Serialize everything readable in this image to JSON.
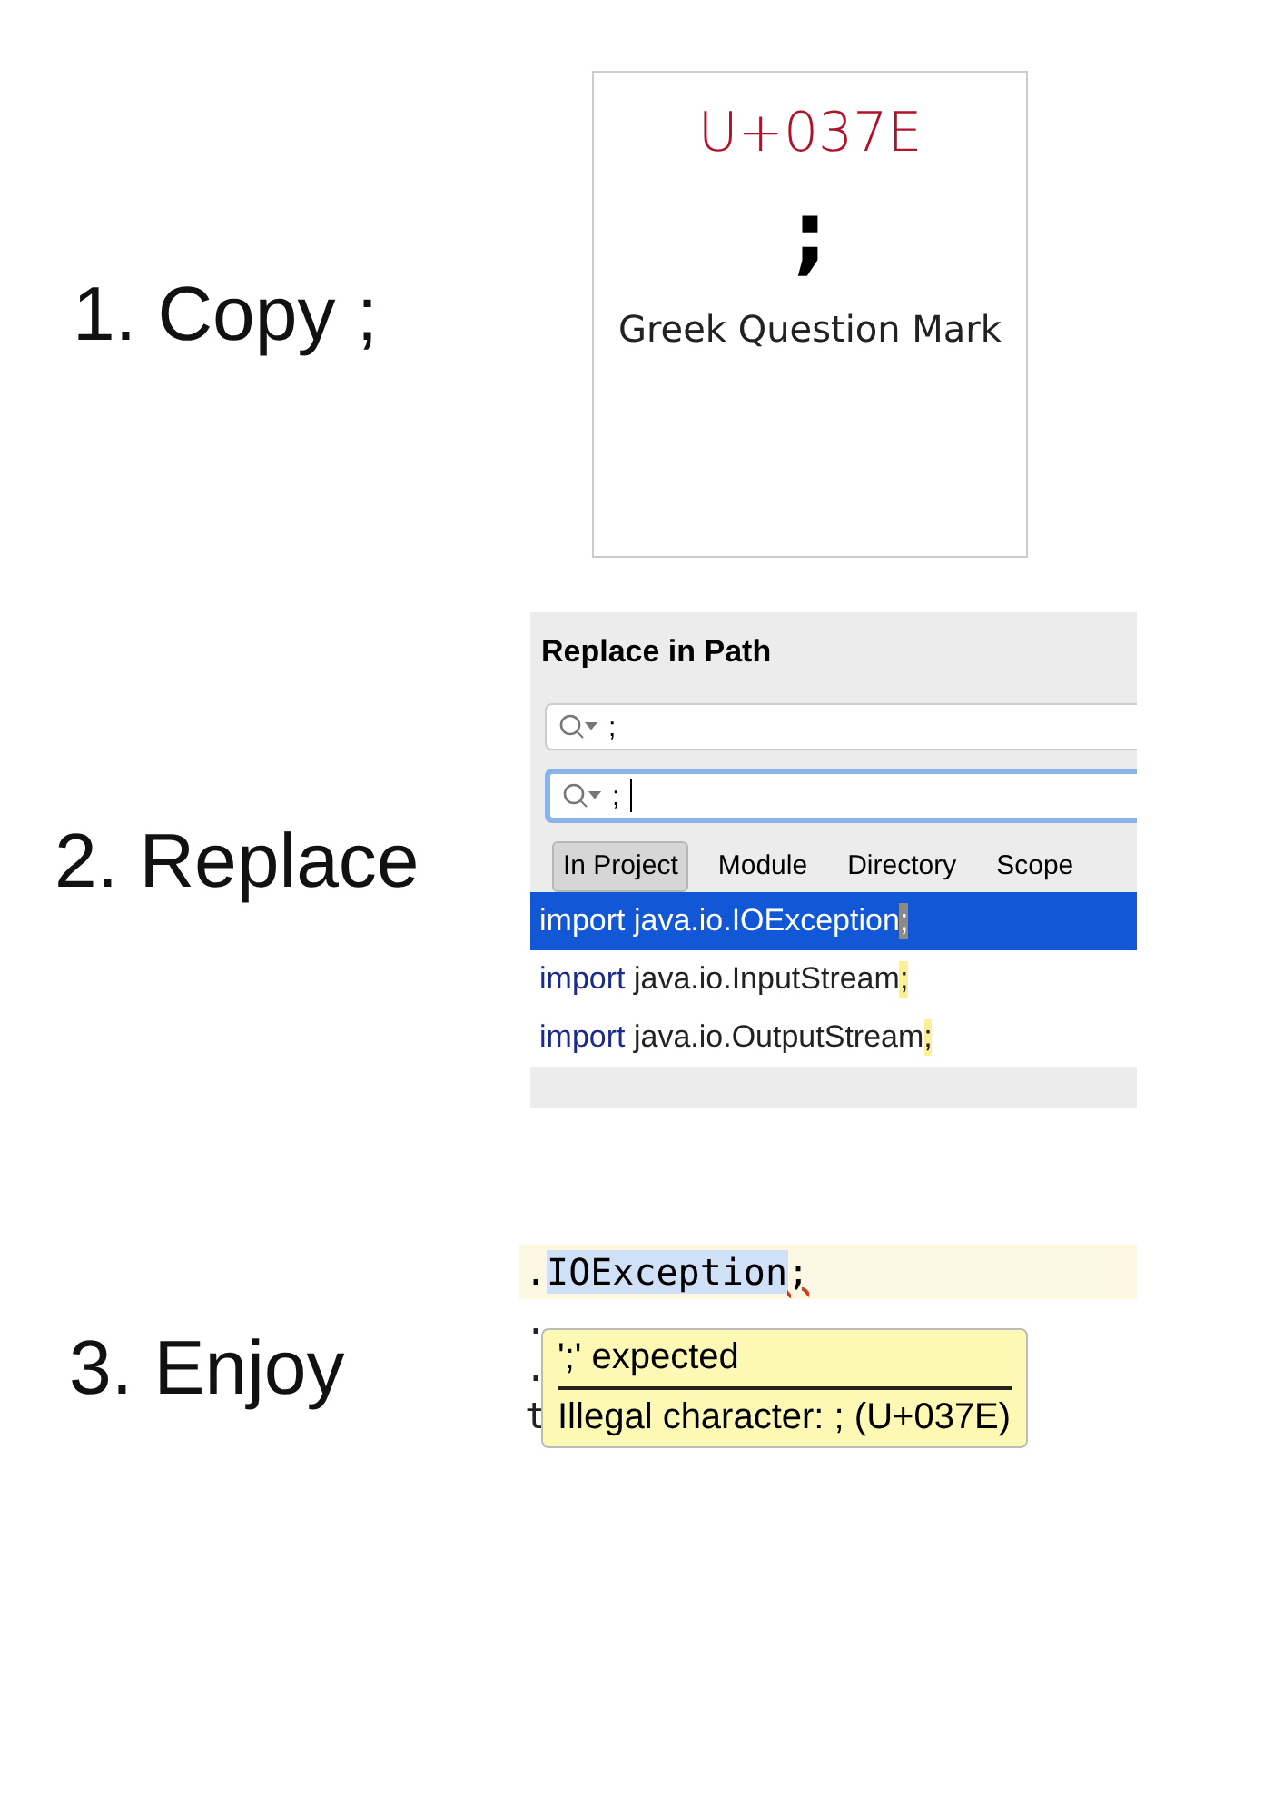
{
  "steps": [
    {
      "label": "1. Copy ;",
      "kind": "char-card",
      "card": {
        "code": "U+037E",
        "glyph": ";",
        "name": "Greek Question Mark"
      }
    },
    {
      "label": "2. Replace",
      "kind": "replace-dialog",
      "dialog": {
        "title": "Replace in Path",
        "find": ";",
        "replace": ";",
        "scopes": [
          {
            "label": "In Project",
            "selected": true
          },
          {
            "label": "Module",
            "selected": false
          },
          {
            "label": "Directory",
            "selected": false
          },
          {
            "label": "Scope",
            "selected": false
          }
        ],
        "results": [
          {
            "keyword": "import",
            "path": "java.io.IOException",
            "mark": ";",
            "selected": true
          },
          {
            "keyword": "import",
            "path": "java.io.InputStream",
            "mark": ";",
            "selected": false
          },
          {
            "keyword": "import",
            "path": "java.io.OutputStream",
            "mark": ";",
            "selected": false
          }
        ]
      }
    },
    {
      "label": "3. Enjoy",
      "kind": "editor-tooltip",
      "editor": {
        "prefix": ".",
        "name": "IOException",
        "mark": ";",
        "hidden_lines": [
          ".",
          ".",
          "t"
        ],
        "tooltip": {
          "title": "';' expected",
          "message": "Illegal character: ; (U+037E)"
        }
      }
    }
  ]
}
